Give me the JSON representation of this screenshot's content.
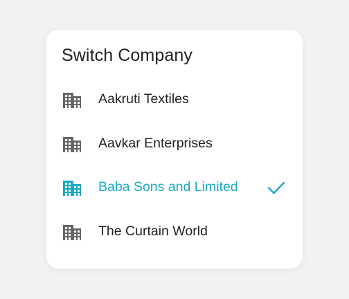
{
  "dialog": {
    "title": "Switch Company"
  },
  "companies": [
    {
      "label": "Aakruti Textiles",
      "icon": "building-icon",
      "selected": false
    },
    {
      "label": "Aavkar Enterprises",
      "icon": "building-icon",
      "selected": false
    },
    {
      "label": "Baba Sons and Limited",
      "icon": "building-icon",
      "selected": true
    },
    {
      "label": "The Curtain World",
      "icon": "building-icon",
      "selected": false
    }
  ],
  "colors": {
    "accent": "#1aa9c7",
    "icon_default": "#666666",
    "text": "#222222",
    "background": "#f2f2f2",
    "card": "#ffffff"
  }
}
